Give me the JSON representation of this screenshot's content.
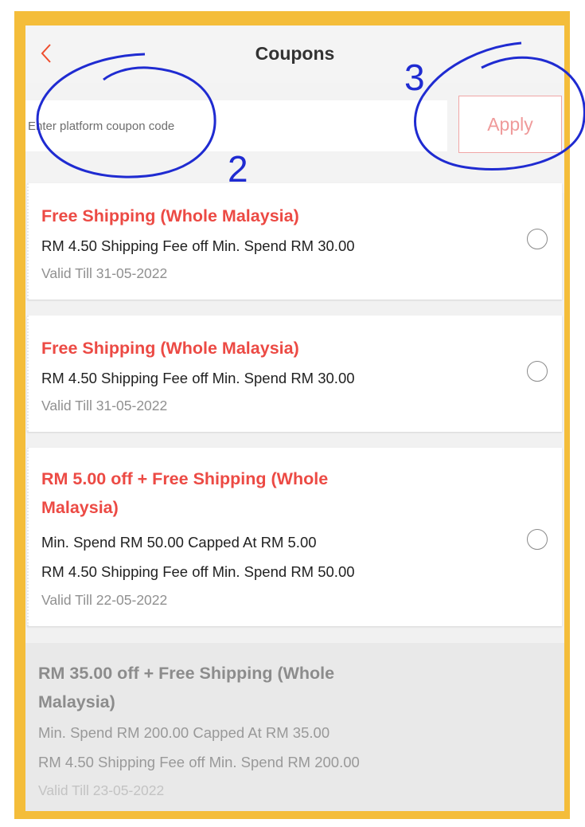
{
  "header": {
    "title": "Coupons",
    "back_icon": "chevron-left-icon",
    "accent_color": "#ee4d2d"
  },
  "coupon_code": {
    "placeholder": "Enter platform coupon code",
    "value": "",
    "apply_label": "Apply"
  },
  "coupons": [
    {
      "title": "Free Shipping (Whole Malaysia)",
      "lines": [
        "RM 4.50 Shipping Fee off Min. Spend RM 30.00"
      ],
      "validity": "Valid Till 31-05-2022",
      "selected": false
    },
    {
      "title": "Free Shipping (Whole Malaysia)",
      "lines": [
        "RM 4.50 Shipping Fee off Min. Spend RM 30.00"
      ],
      "validity": "Valid Till 31-05-2022",
      "selected": false
    },
    {
      "title_line1": "RM 5.00 off + Free Shipping (Whole",
      "title_line2": "Malaysia)",
      "lines": [
        "Min. Spend RM 50.00 Capped At RM 5.00",
        "RM 4.50 Shipping Fee off Min. Spend RM 50.00"
      ],
      "validity": "Valid Till 22-05-2022",
      "selected": false
    }
  ],
  "unavailable_coupons": [
    {
      "title_line1": "RM 35.00 off + Free Shipping (Whole",
      "title_line2": "Malaysia)",
      "lines": [
        "Min. Spend RM 200.00 Capped At RM 35.00",
        "RM 4.50 Shipping Fee off Min. Spend RM 200.00"
      ],
      "validity": "Valid Till 23-05-2022"
    }
  ],
  "annotations": [
    {
      "label": "2",
      "color": "#1f2bd1"
    },
    {
      "label": "3",
      "color": "#1f2bd1"
    }
  ],
  "frame_color": "#f4bd3a"
}
